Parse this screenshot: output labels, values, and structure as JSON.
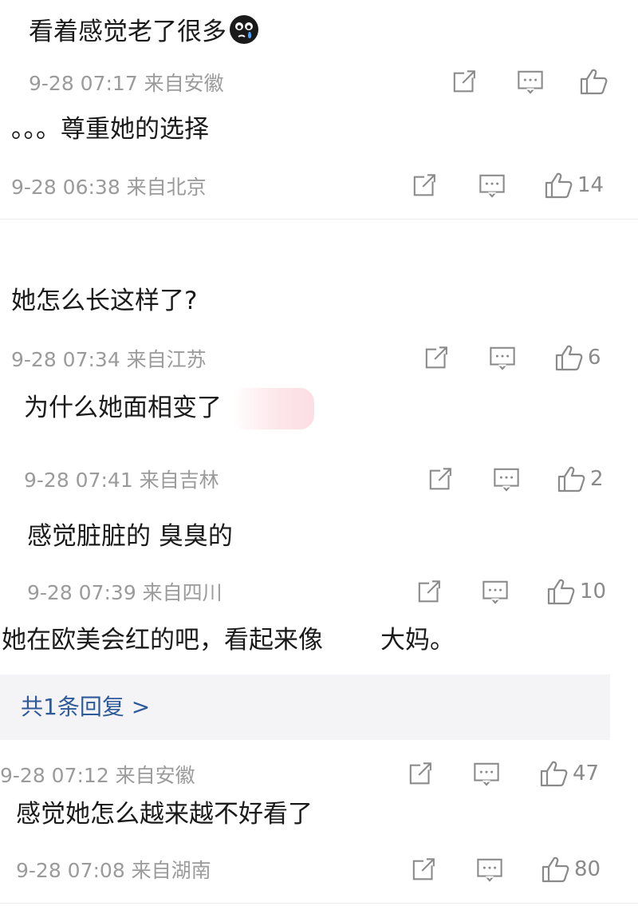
{
  "comments": [
    {
      "text": "看着感觉老了很多",
      "emoji": "crying-face",
      "meta": "9-28 07:17 来自安徽",
      "likes": ""
    },
    {
      "text": "。。。尊重她的选择",
      "meta": "9-28 06:38 来自北京",
      "likes": "14"
    },
    {
      "text": "她怎么长这样了?",
      "meta": "9-28 07:34 来自江苏",
      "likes": "6"
    },
    {
      "text": "为什么她面相变了",
      "meta": "9-28 07:41 来自吉林",
      "likes": "2"
    },
    {
      "text": "感觉脏脏的 臭臭的",
      "meta": "9-28 07:39 来自四川",
      "likes": "10"
    },
    {
      "text_part1": "她在欧美会红的吧，看起来像",
      "text_part2": "大妈。",
      "reply_link": "共1条回复 >",
      "meta": "9-28 07:12 来自安徽",
      "likes": "47"
    },
    {
      "text": "感觉她怎么越来越不好看了",
      "meta": "9-28 07:08 来自湖南",
      "likes": "80"
    }
  ],
  "icons": {
    "share": "share-icon",
    "reply": "comment-icon",
    "like": "thumbs-up-icon"
  },
  "colors": {
    "text": "#1a1a1a",
    "meta": "#9b9b9b",
    "link": "#2f5a9a",
    "reply_bg": "#f4f4f6"
  }
}
